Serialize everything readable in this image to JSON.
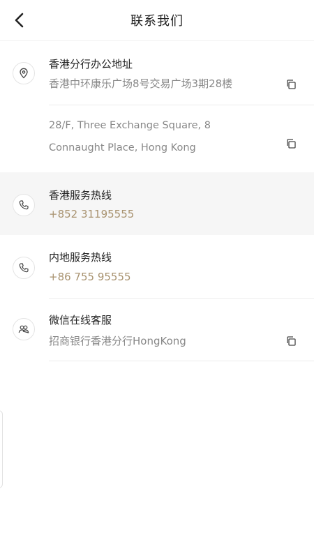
{
  "header": {
    "title": "联系我们"
  },
  "address": {
    "title": "香港分行办公地址",
    "chinese": "香港中环康乐广场8号交易广场3期28楼",
    "english_line1": "28/F, Three Exchange Square, 8",
    "english_line2": "Connaught Place, Hong Kong"
  },
  "hk_hotline": {
    "title": "香港服务热线",
    "number": "+852 31195555"
  },
  "mainland_hotline": {
    "title": "内地服务热线",
    "number": "+86 755 95555"
  },
  "wechat": {
    "title": "微信在线客服",
    "account": "招商银行香港分行HongKong"
  },
  "icons": {
    "back": "chevron-left-icon",
    "location": "location-pin-icon",
    "phone": "phone-icon",
    "wechat": "people-icon",
    "copy": "copy-icon"
  },
  "colors": {
    "accent_gold": "#a8926f",
    "text_gray": "#888888",
    "shaded_row": "#f6f6f6"
  }
}
